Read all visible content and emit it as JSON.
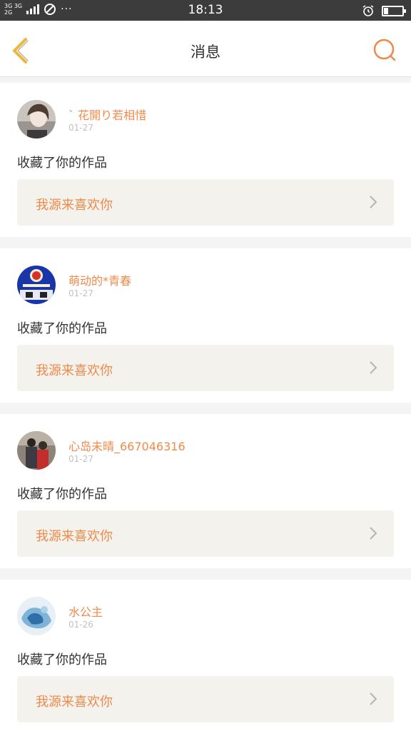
{
  "status_bar": {
    "network_top": "3G 3G",
    "network_bottom": "2G",
    "more": "···",
    "time": "18:13",
    "battery_level": 0.25
  },
  "header": {
    "title": "消息"
  },
  "messages": [
    {
      "username": "` 花開り若相惜",
      "date": "01-27",
      "action": "收藏了你的作品",
      "work_title": "我源来喜欢你"
    },
    {
      "username": "萌动的*青春",
      "date": "01-27",
      "action": "收藏了你的作品",
      "work_title": "我源来喜欢你"
    },
    {
      "username": "心岛未晴_667046316",
      "date": "01-27",
      "action": "收藏了你的作品",
      "work_title": "我源来喜欢你"
    },
    {
      "username": "水公主",
      "date": "01-26",
      "action": "收藏了你的作品",
      "work_title": "我源来喜欢你"
    }
  ],
  "colors": {
    "accent": "#f08a4b",
    "back_arrow": "#f0b63c",
    "card_box": "#f3f2ed"
  }
}
